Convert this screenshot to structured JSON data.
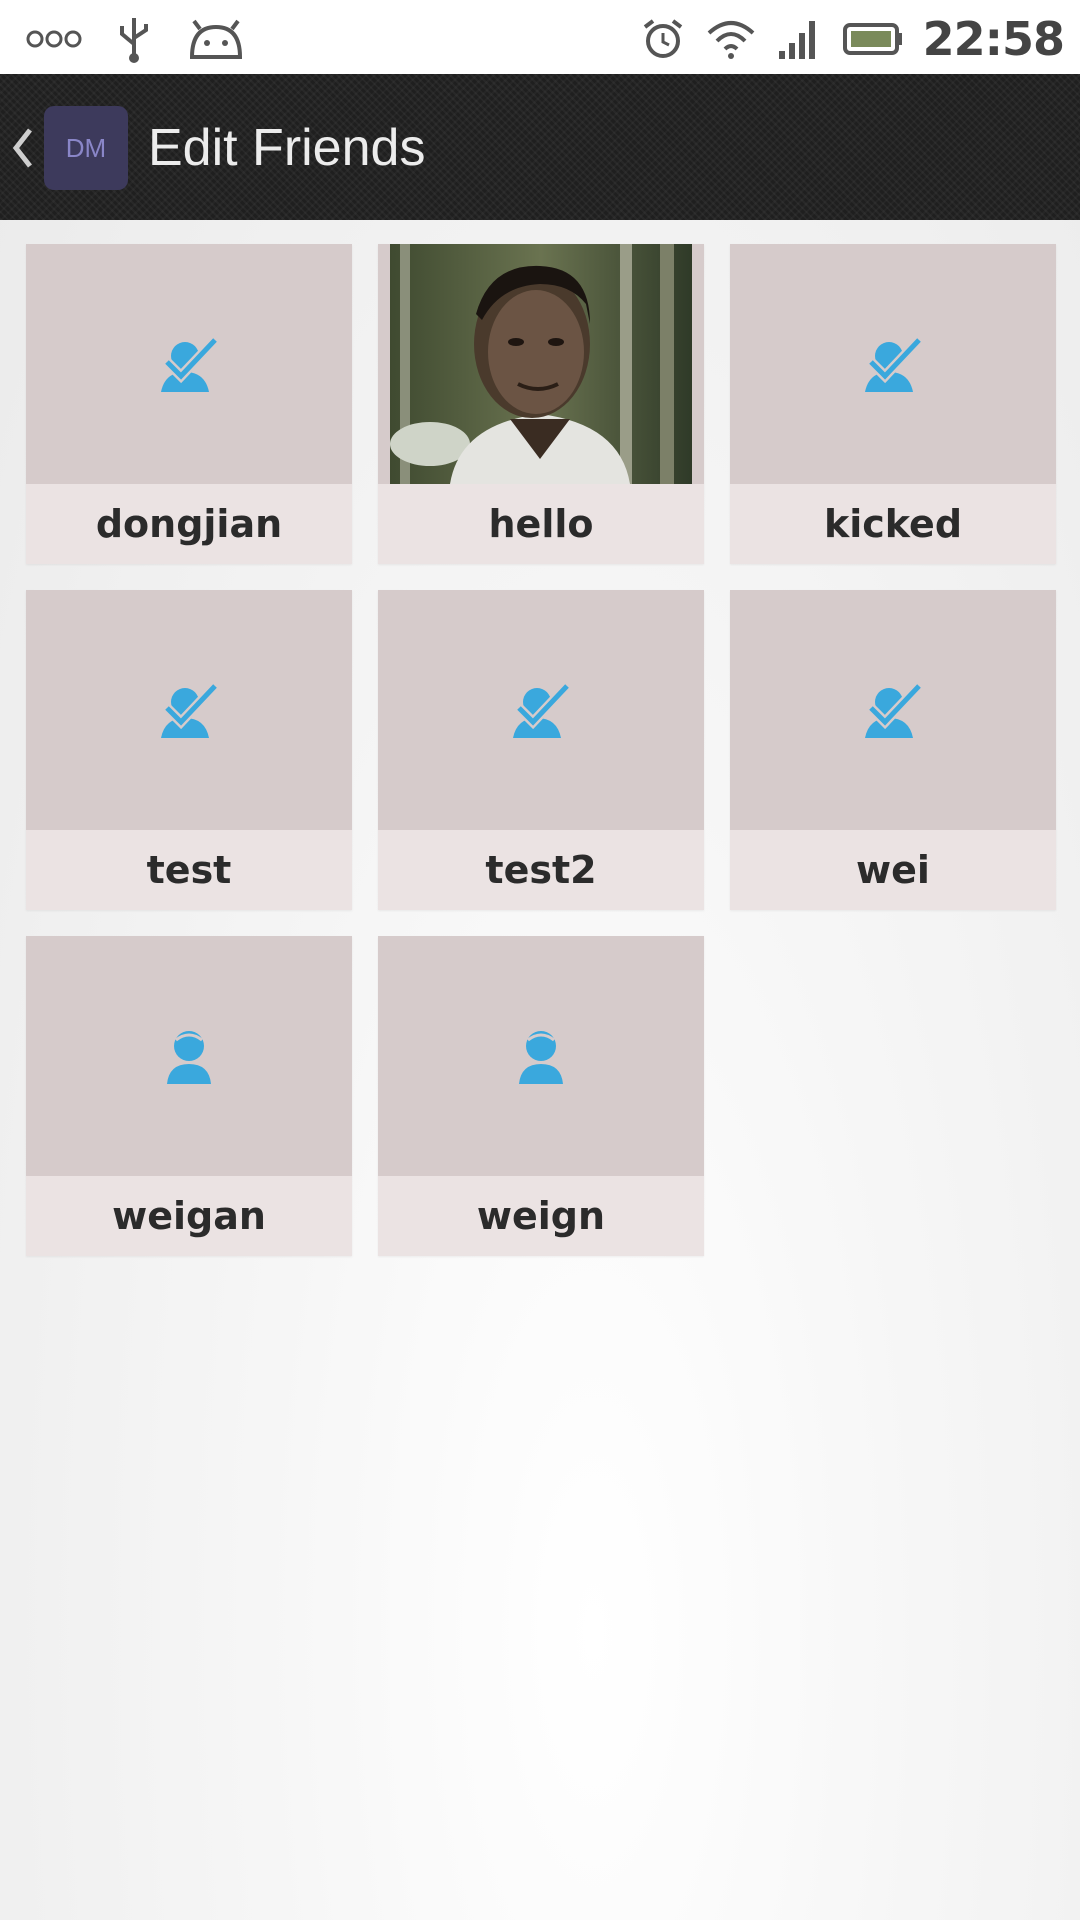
{
  "status_bar": {
    "clock": "22:58",
    "left_icons": [
      "overflow-dots-icon",
      "usb-icon",
      "android-icon"
    ],
    "right_icons": [
      "alarm-icon",
      "wifi-icon",
      "signal-icon",
      "battery-icon"
    ]
  },
  "action_bar": {
    "title": "Edit Friends",
    "logo_text": "DM",
    "back_icon": "chevron-left-icon"
  },
  "friends": [
    {
      "name": "dongjian",
      "avatar": "placeholder-checked"
    },
    {
      "name": "hello",
      "avatar": "photo"
    },
    {
      "name": "kicked",
      "avatar": "placeholder-checked"
    },
    {
      "name": "test",
      "avatar": "placeholder-checked"
    },
    {
      "name": "test2",
      "avatar": "placeholder-checked"
    },
    {
      "name": "wei",
      "avatar": "placeholder-checked"
    },
    {
      "name": "weigan",
      "avatar": "placeholder"
    },
    {
      "name": "weign",
      "avatar": "placeholder"
    }
  ],
  "colors": {
    "accent": "#3aa8dd",
    "tile_photo_bg": "#d6cbcb",
    "tile_label_bg": "#ebe3e3",
    "action_bar_bg": "#1f1f1f"
  }
}
